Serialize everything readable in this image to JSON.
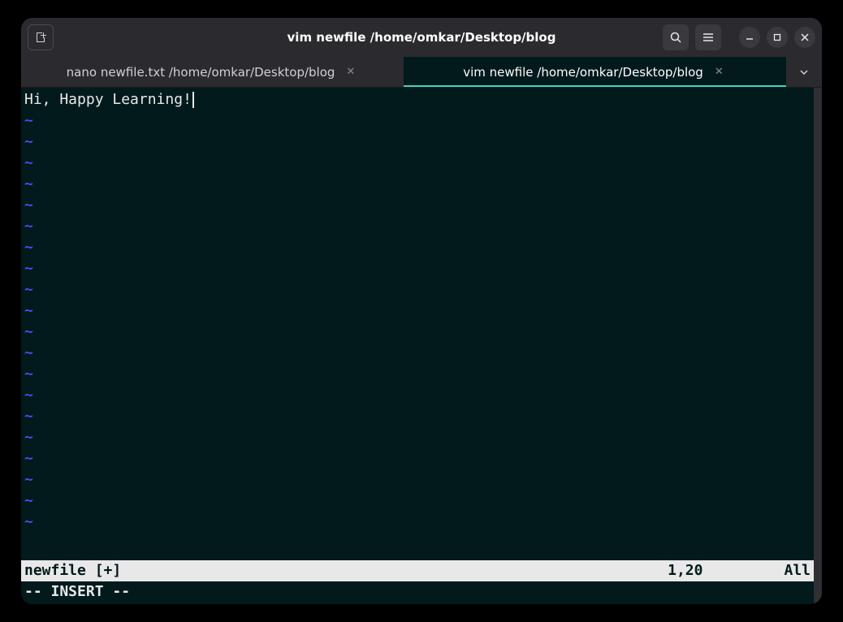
{
  "window": {
    "title": "vim newfile /home/omkar/Desktop/blog"
  },
  "titlebar": {
    "icons": {
      "newtab": "new-tab-icon",
      "search": "search-icon",
      "menu": "hamburger-icon",
      "minimize": "minimize-icon",
      "maximize": "maximize-icon",
      "close": "close-icon"
    }
  },
  "tabs": [
    {
      "label": "nano newfile.txt /home/omkar/Desktop/blog",
      "active": false
    },
    {
      "label": "vim newfile /home/omkar/Desktop/blog",
      "active": true
    }
  ],
  "editor": {
    "content_line": "Hi, Happy Learning!",
    "tilde_char": "~",
    "tilde_count": 20
  },
  "status": {
    "filename": "newfile [+]",
    "position": "1,20",
    "percent": "All"
  },
  "mode": "-- INSERT --"
}
